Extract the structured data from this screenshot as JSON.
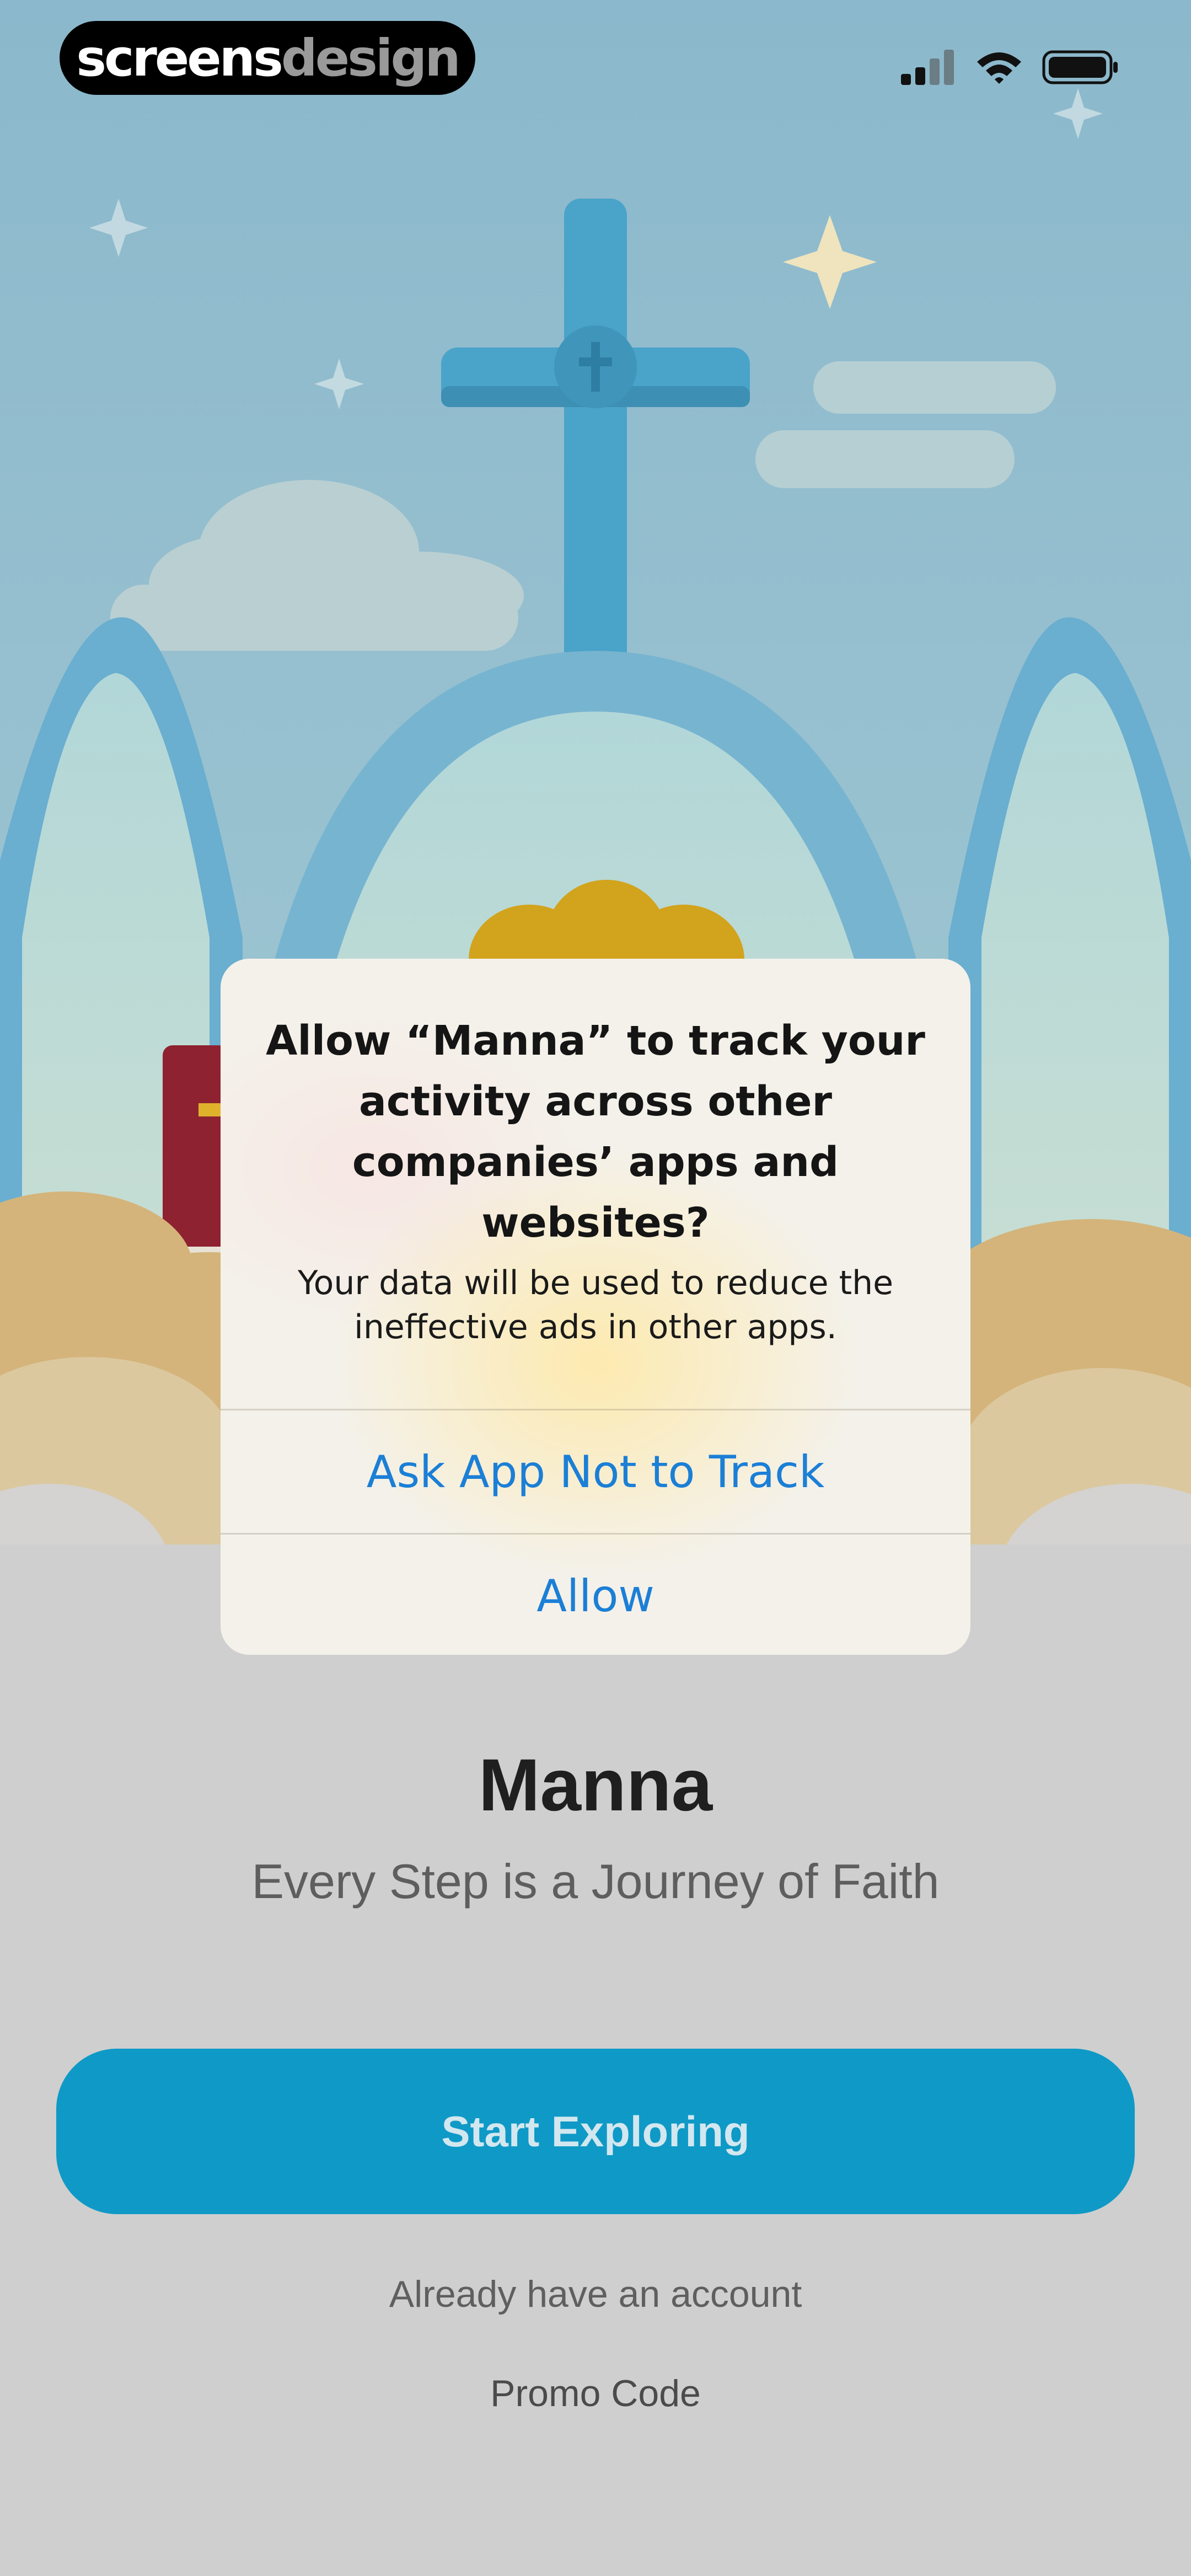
{
  "watermark": {
    "part1": "screens",
    "part2": "design"
  },
  "status_bar": {
    "icons": [
      "cellular-signal-icon",
      "wifi-icon",
      "battery-icon"
    ]
  },
  "alert": {
    "title": "Allow “Manna” to track your activity across other companies’ apps and websites?",
    "message": "Your data will be used to reduce the ineffective ads in other apps.",
    "ask_not_to_track_label": "Ask App Not to Track",
    "allow_label": "Allow"
  },
  "app": {
    "title": "Manna",
    "tagline": "Every Step is a Journey of Faith",
    "start_button_label": "Start Exploring",
    "account_link": "Already have an account",
    "promo_link": "Promo Code"
  },
  "colors": {
    "accent": "#0f99c6",
    "alert_action": "#1b7fd6",
    "sky": "#8ab7cc",
    "cross": "#4aa3c9"
  }
}
